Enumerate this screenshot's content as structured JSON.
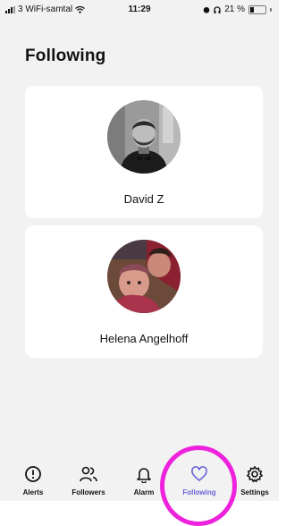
{
  "status_bar": {
    "carrier": "3 WiFi-samtal",
    "time": "11:29",
    "battery": "21 %"
  },
  "page": {
    "title": "Following"
  },
  "following": [
    {
      "name": "David Z"
    },
    {
      "name": "Helena Angelhoff"
    }
  ],
  "tab_bar": {
    "active": "Following",
    "active_color": "#6c63d8",
    "items": [
      {
        "label": "Alerts",
        "icon": "alert-circle-icon"
      },
      {
        "label": "Followers",
        "icon": "users-icon"
      },
      {
        "label": "Alarm",
        "icon": "bell-icon"
      },
      {
        "label": "Following",
        "icon": "heart-icon"
      },
      {
        "label": "Settings",
        "icon": "gear-icon"
      }
    ]
  },
  "annotation": {
    "highlight_color": "#ee22dd"
  }
}
